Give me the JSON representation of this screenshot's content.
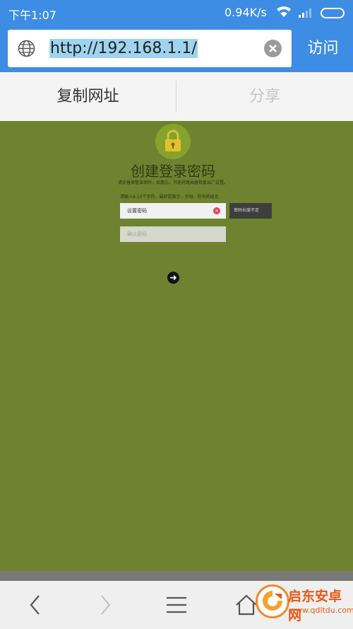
{
  "status_bar": {
    "time": "下午1:07",
    "network_speed": "0.94K/s"
  },
  "browser": {
    "url": "http://192.168.1.1/",
    "visit_label": "访问",
    "copy_label": "复制网址",
    "share_label": "分享"
  },
  "page": {
    "title": "创建登录密码",
    "subtitle": "请妥善保管该密码，如遗忘，只能将路由器恢复出厂设置。",
    "hint": "请输入6-15个字符，最好是数字、字母、符号的组合",
    "password_label": "设置密码",
    "tooltip": "密码长度不足",
    "confirm_placeholder": "确认密码"
  },
  "watermark": {
    "title": "启东安卓网",
    "url": "www.qdltdu.com"
  },
  "colors": {
    "accent": "#3d8de4",
    "page_bg": "#6e8230",
    "error": "#dd4757"
  }
}
